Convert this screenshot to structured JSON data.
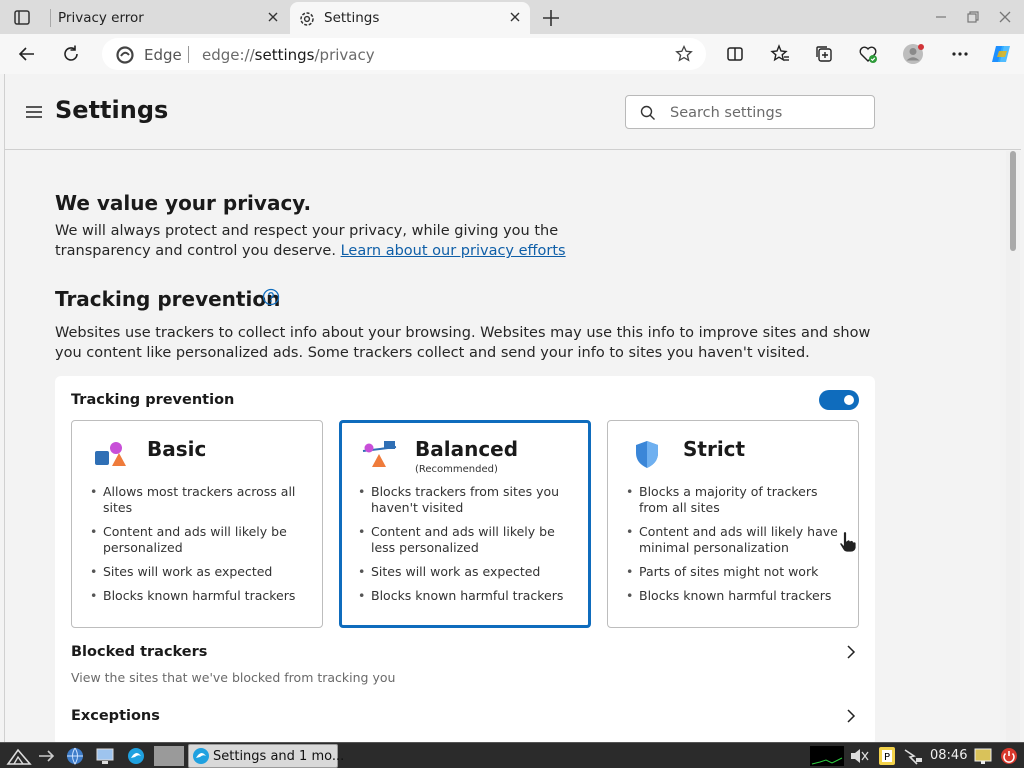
{
  "browser": {
    "tabs": [
      {
        "label": "Privacy error",
        "active": false
      },
      {
        "label": "Settings",
        "active": true
      }
    ],
    "address": {
      "brand": "Edge",
      "url_prefix": "edge://",
      "url_host": "settings",
      "url_path": "/privacy"
    }
  },
  "settings": {
    "title": "Settings",
    "search_placeholder": "Search settings"
  },
  "privacy": {
    "heading": "We value your privacy.",
    "text": "We will always protect and respect your privacy, while giving you the transparency and control you deserve.",
    "link": "Learn about our privacy efforts"
  },
  "tracking": {
    "heading": "Tracking prevention",
    "description": "Websites use trackers to collect info about your browsing. Websites may use this info to improve sites and show you content like personalized ads. Some trackers collect and send your info to sites you haven't visited.",
    "card_title": "Tracking prevention",
    "toggle_on": true,
    "options": [
      {
        "title": "Basic",
        "subtitle": "",
        "selected": false,
        "bullets": [
          "Allows most trackers across all sites",
          "Content and ads will likely be personalized",
          "Sites will work as expected",
          "Blocks known harmful trackers"
        ]
      },
      {
        "title": "Balanced",
        "subtitle": "(Recommended)",
        "selected": true,
        "bullets": [
          "Blocks trackers from sites you haven't visited",
          "Content and ads will likely be less personalized",
          "Sites will work as expected",
          "Blocks known harmful trackers"
        ]
      },
      {
        "title": "Strict",
        "subtitle": "",
        "selected": false,
        "bullets": [
          "Blocks a majority of trackers from all sites",
          "Content and ads will likely have minimal personalization",
          "Parts of sites might not work",
          "Blocks known harmful trackers"
        ]
      }
    ],
    "blocked_title": "Blocked trackers",
    "blocked_sub": "View the sites that we've blocked from tracking you",
    "exceptions_title": "Exceptions"
  },
  "taskbar": {
    "app_label": "Settings and 1 mo...",
    "clock": "08:46"
  },
  "colors": {
    "accent": "#0f6cbd",
    "link": "#0f5fa8"
  }
}
